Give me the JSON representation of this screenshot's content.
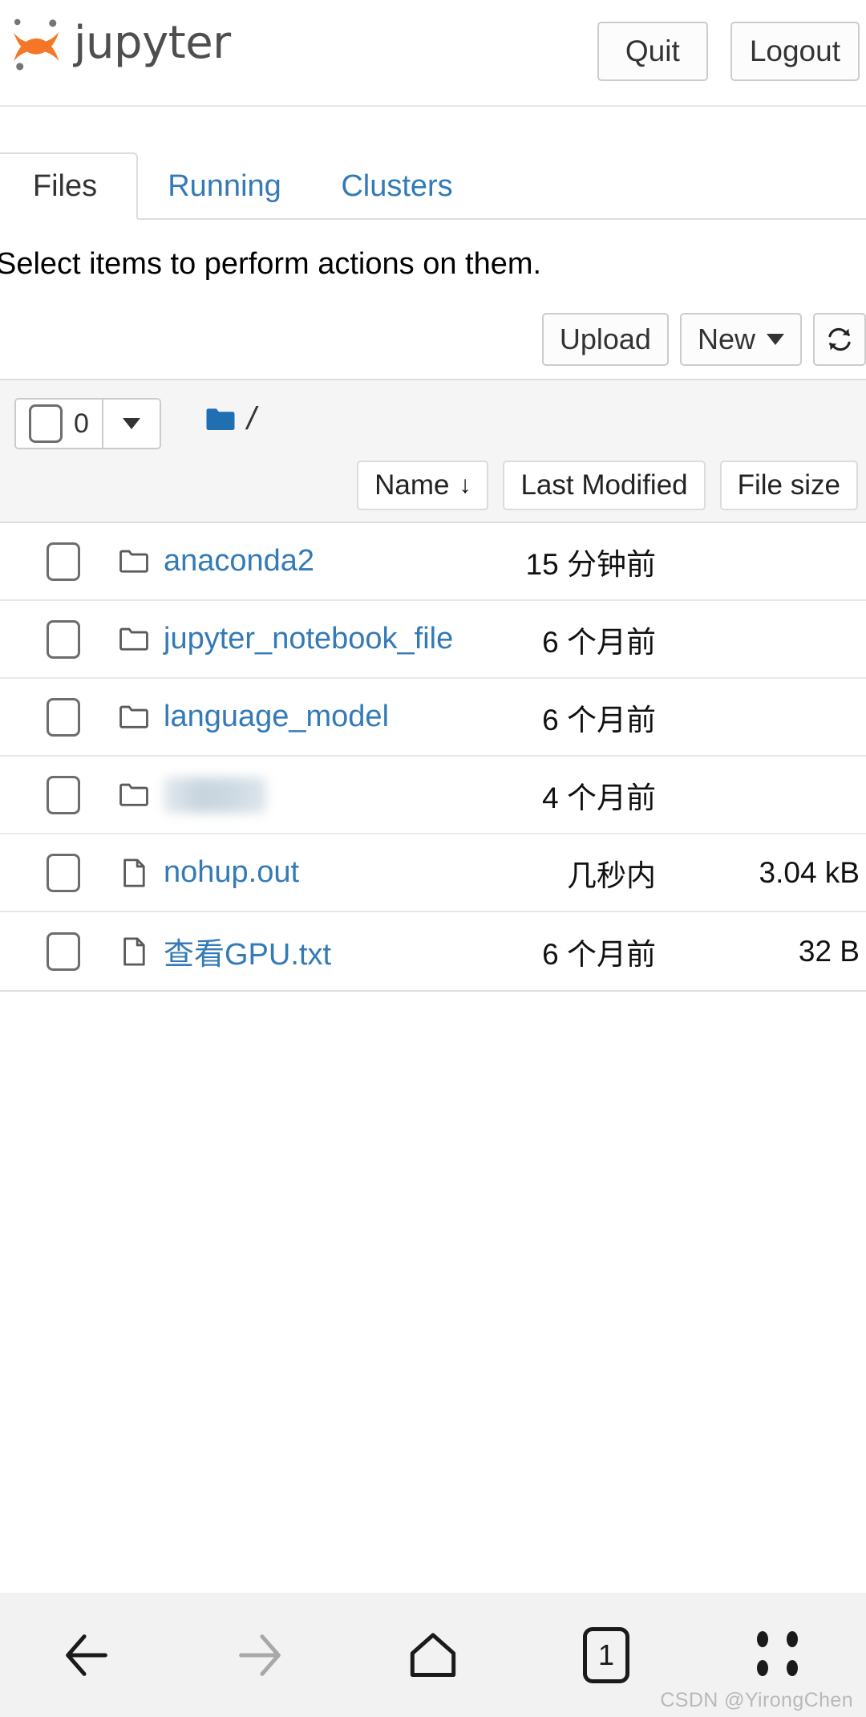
{
  "header": {
    "brand": "jupyter",
    "logo_icon": "jupyter-logo-icon",
    "quit_label": "Quit",
    "logout_label": "Logout"
  },
  "tabs": [
    {
      "label": "Files",
      "active": true
    },
    {
      "label": "Running",
      "active": false
    },
    {
      "label": "Clusters",
      "active": false
    }
  ],
  "notebook": {
    "select_prompt": "Select items to perform actions on them.",
    "upload_label": "Upload",
    "new_label": "New",
    "refresh_icon": "refresh-icon",
    "selected_count": "0",
    "breadcrumb_root": "/",
    "folder_icon": "folder-filled-icon",
    "columns": {
      "name": "Name",
      "name_sort_arrow": "↓",
      "last_modified": "Last Modified",
      "file_size": "File size"
    },
    "rows": [
      {
        "type": "folder",
        "icon": "folder-outline-icon",
        "name": "anaconda2",
        "modified": "15 分钟前",
        "size": "",
        "redacted": false
      },
      {
        "type": "folder",
        "icon": "folder-outline-icon",
        "name": "jupyter_notebook_file",
        "modified": "6 个月前",
        "size": "",
        "redacted": false
      },
      {
        "type": "folder",
        "icon": "folder-outline-icon",
        "name": "language_model",
        "modified": "6 个月前",
        "size": "",
        "redacted": false
      },
      {
        "type": "folder",
        "icon": "folder-outline-icon",
        "name": "",
        "modified": "4 个月前",
        "size": "",
        "redacted": true
      },
      {
        "type": "file",
        "icon": "file-icon",
        "name": "nohup.out",
        "modified": "几秒内",
        "size": "3.04 kB",
        "redacted": false
      },
      {
        "type": "file",
        "icon": "file-icon",
        "name": "查看GPU.txt",
        "modified": "6 个月前",
        "size": "32 B",
        "redacted": false
      }
    ]
  },
  "bottom_nav": {
    "back_icon": "arrow-left-icon",
    "forward_icon": "arrow-right-icon",
    "home_icon": "home-icon",
    "tab_count": "1",
    "menu_icon": "more-dots-icon"
  },
  "watermark": "CSDN @YirongChen",
  "colors": {
    "link": "#337ab7",
    "logo_orange": "#f37726",
    "logo_gray": "#767677",
    "toolbar_bg": "#f5f5f5",
    "border": "#dddddd",
    "botnav_bg": "#f2f2f3"
  }
}
